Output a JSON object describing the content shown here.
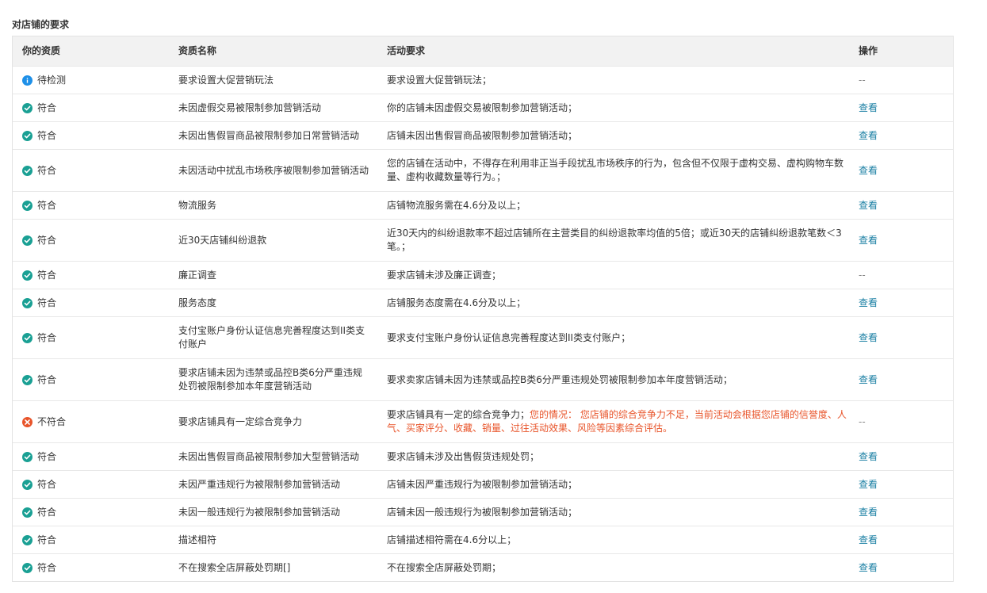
{
  "section_title": "对店铺的要求",
  "header": {
    "col1": "你的资质",
    "col2": "资质名称",
    "col3": "活动要求",
    "col4": "操作"
  },
  "rows": [
    {
      "status": "info",
      "status_label": "待检测",
      "name": "要求设置大促营销玩法",
      "requirement": "要求设置大促营销玩法；",
      "requirement_extra": "",
      "action": "--",
      "action_type": "dash"
    },
    {
      "status": "ok",
      "status_label": "符合",
      "name": "未因虚假交易被限制参加营销活动",
      "requirement": "你的店铺未因虚假交易被限制参加营销活动；",
      "requirement_extra": "",
      "action": "查看",
      "action_type": "link"
    },
    {
      "status": "ok",
      "status_label": "符合",
      "name": "未因出售假冒商品被限制参加日常营销活动",
      "requirement": "店铺未因出售假冒商品被限制参加营销活动；",
      "requirement_extra": "",
      "action": "查看",
      "action_type": "link"
    },
    {
      "status": "ok",
      "status_label": "符合",
      "name": "未因活动中扰乱市场秩序被限制参加营销活动",
      "requirement": "您的店铺在活动中，不得存在利用非正当手段扰乱市场秩序的行为，包含但不仅限于虚构交易、虚构购物车数量、虚构收藏数量等行为。；",
      "requirement_extra": "",
      "action": "查看",
      "action_type": "link"
    },
    {
      "status": "ok",
      "status_label": "符合",
      "name": "物流服务",
      "requirement": "店铺物流服务需在4.6分及以上；",
      "requirement_extra": "",
      "action": "查看",
      "action_type": "link"
    },
    {
      "status": "ok",
      "status_label": "符合",
      "name": "近30天店铺纠纷退款",
      "requirement": "近30天内的纠纷退款率不超过店铺所在主营类目的纠纷退款率均值的5倍；或近30天的店铺纠纷退款笔数＜3笔。；",
      "requirement_extra": "",
      "action": "查看",
      "action_type": "link"
    },
    {
      "status": "ok",
      "status_label": "符合",
      "name": "廉正调查",
      "requirement": "要求店铺未涉及廉正调查；",
      "requirement_extra": "",
      "action": "--",
      "action_type": "dash"
    },
    {
      "status": "ok",
      "status_label": "符合",
      "name": "服务态度",
      "requirement": "店铺服务态度需在4.6分及以上；",
      "requirement_extra": "",
      "action": "查看",
      "action_type": "link"
    },
    {
      "status": "ok",
      "status_label": "符合",
      "name": "支付宝账户身份认证信息完善程度达到II类支付账户",
      "requirement": "要求支付宝账户身份认证信息完善程度达到II类支付账户；",
      "requirement_extra": "",
      "action": "查看",
      "action_type": "link"
    },
    {
      "status": "ok",
      "status_label": "符合",
      "name": "要求店铺未因为违禁或品控B类6分严重违规处罚被限制参加本年度营销活动",
      "requirement": "要求卖家店铺未因为违禁或品控B类6分严重违规处罚被限制参加本年度营销活动；",
      "requirement_extra": "",
      "action": "查看",
      "action_type": "link"
    },
    {
      "status": "bad",
      "status_label": "不符合",
      "name": "要求店铺具有一定综合竞争力",
      "requirement": "要求店铺具有一定的综合竞争力；",
      "requirement_extra": "您的情况： 您店铺的综合竞争力不足，当前活动会根据您店铺的信誉度、人气、买家评分、收藏、销量、过往活动效果、风险等因素综合评估。",
      "action": "--",
      "action_type": "dash"
    },
    {
      "status": "ok",
      "status_label": "符合",
      "name": "未因出售假冒商品被限制参加大型营销活动",
      "requirement": "要求店铺未涉及出售假货违规处罚；",
      "requirement_extra": "",
      "action": "查看",
      "action_type": "link"
    },
    {
      "status": "ok",
      "status_label": "符合",
      "name": "未因严重违规行为被限制参加营销活动",
      "requirement": "店铺未因严重违规行为被限制参加营销活动；",
      "requirement_extra": "",
      "action": "查看",
      "action_type": "link"
    },
    {
      "status": "ok",
      "status_label": "符合",
      "name": "未因一般违规行为被限制参加营销活动",
      "requirement": "店铺未因一般违规行为被限制参加营销活动；",
      "requirement_extra": "",
      "action": "查看",
      "action_type": "link"
    },
    {
      "status": "ok",
      "status_label": "符合",
      "name": "描述相符",
      "requirement": "店铺描述相符需在4.6分以上；",
      "requirement_extra": "",
      "action": "查看",
      "action_type": "link"
    },
    {
      "status": "ok",
      "status_label": "符合",
      "name": "不在搜索全店屏蔽处罚期[]",
      "requirement": "不在搜索全店屏蔽处罚期；",
      "requirement_extra": "",
      "action": "查看",
      "action_type": "link"
    }
  ]
}
